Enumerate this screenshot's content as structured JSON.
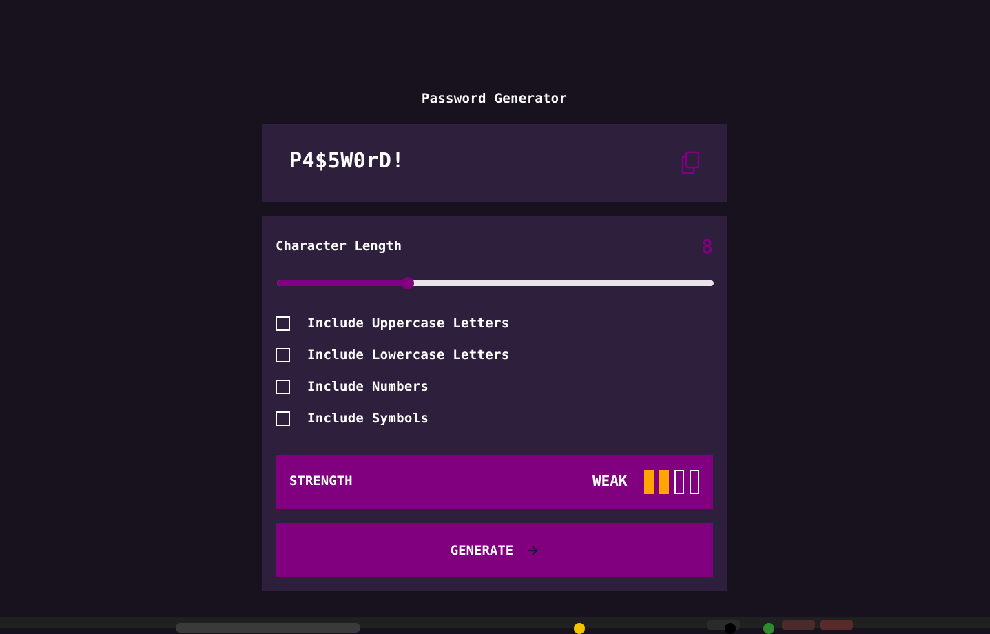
{
  "header": {
    "title": "Password Generator"
  },
  "output": {
    "password": "P4$5W0rD!",
    "copy_icon": "copy-icon"
  },
  "length": {
    "label": "Character Length",
    "value": "8",
    "slider_fraction": 0.3
  },
  "options": [
    {
      "label": "Include Uppercase Letters",
      "checked": false
    },
    {
      "label": "Include Lowercase Letters",
      "checked": false
    },
    {
      "label": "Include Numbers",
      "checked": false
    },
    {
      "label": "Include Symbols",
      "checked": false
    }
  ],
  "strength": {
    "label": "STRENGTH",
    "rating": "WEAK",
    "filled_bars": 2,
    "total_bars": 4
  },
  "generate": {
    "label": "GENERATE",
    "icon": "arrow-right-icon"
  },
  "colors": {
    "background": "#18121f",
    "panel": "#2e1f3c",
    "accent": "#800080",
    "strength_bar": "#ffa500"
  }
}
